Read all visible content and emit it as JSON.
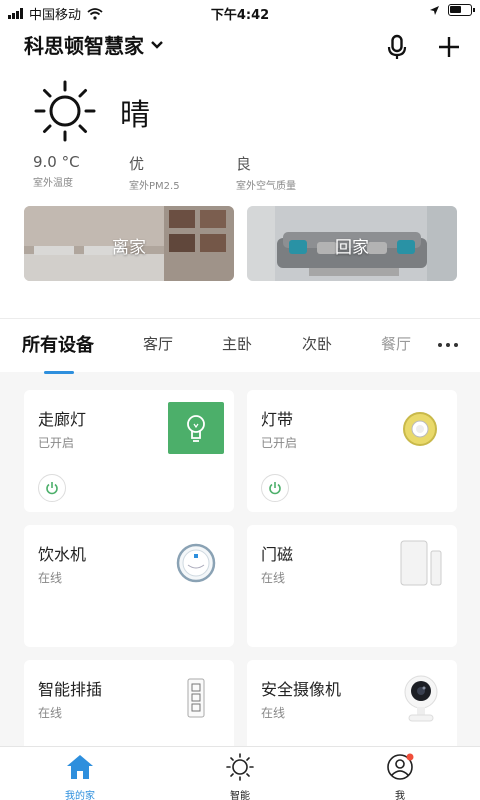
{
  "status": {
    "carrier": "中国移动",
    "time": "下午4:42"
  },
  "header": {
    "home_name": "科思顿智慧家"
  },
  "weather": {
    "condition": "晴",
    "stats": [
      {
        "value": "9.0 °C",
        "label": "室外温度"
      },
      {
        "value": "优",
        "label": "室外PM2.5"
      },
      {
        "value": "良",
        "label": "室外空气质量"
      }
    ]
  },
  "scenes": [
    {
      "label": "离家"
    },
    {
      "label": "回家"
    }
  ],
  "tabs": [
    {
      "label": "所有设备",
      "active": true
    },
    {
      "label": "客厅"
    },
    {
      "label": "主卧"
    },
    {
      "label": "次卧"
    },
    {
      "label": "餐厅"
    }
  ],
  "devices": [
    {
      "name": "走廊灯",
      "status": "已开启",
      "icon": "bulb-icon"
    },
    {
      "name": "灯带",
      "status": "已开启",
      "icon": "light-strip-icon"
    },
    {
      "name": "饮水机",
      "status": "在线",
      "icon": "water-dispenser-icon"
    },
    {
      "name": "门磁",
      "status": "在线",
      "icon": "door-sensor-icon"
    },
    {
      "name": "智能排插",
      "status": "在线",
      "icon": "power-strip-icon"
    },
    {
      "name": "安全摄像机",
      "status": "在线",
      "icon": "camera-icon"
    }
  ],
  "nav": [
    {
      "label": "我的家",
      "active": true
    },
    {
      "label": "智能"
    },
    {
      "label": "我"
    }
  ],
  "colors": {
    "accent": "#2e8fdd",
    "bulb_tile": "#4caf6a",
    "badge": "#f04e3a"
  }
}
